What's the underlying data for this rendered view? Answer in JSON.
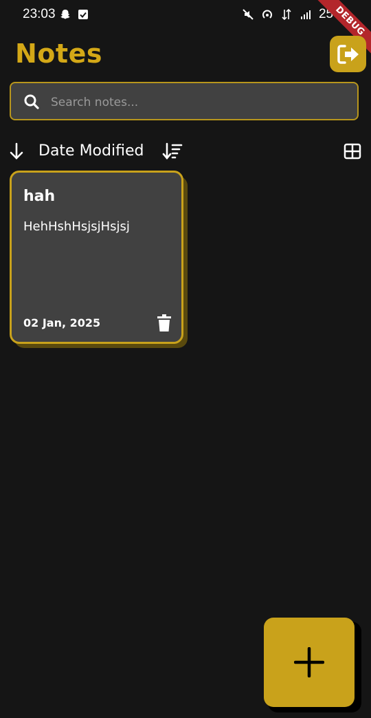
{
  "status_bar": {
    "time": "23:03",
    "battery": "25%",
    "debug_label": "DEBUG",
    "icons": [
      "snapchat-icon",
      "checkbox-icon",
      "mute-icon",
      "hotspot-icon",
      "data-arrows-icon",
      "signal-icon",
      "battery-icon"
    ]
  },
  "header": {
    "title": "Notes",
    "logout_icon": "logout-icon"
  },
  "search": {
    "placeholder": "Search notes...",
    "value": ""
  },
  "sort": {
    "direction_icon": "arrow-down-icon",
    "label": "Date Modified",
    "sort_icon": "sort-icon",
    "view_icon": "grid-icon"
  },
  "notes": [
    {
      "title": "hah",
      "body": "HehHshHsjsjHsjsj",
      "date": "02 Jan, 2025"
    }
  ],
  "fab": {
    "icon": "plus-icon"
  },
  "colors": {
    "background": "#151515",
    "accent": "#c9a21b",
    "title": "#d4a817",
    "card": "#414141"
  }
}
